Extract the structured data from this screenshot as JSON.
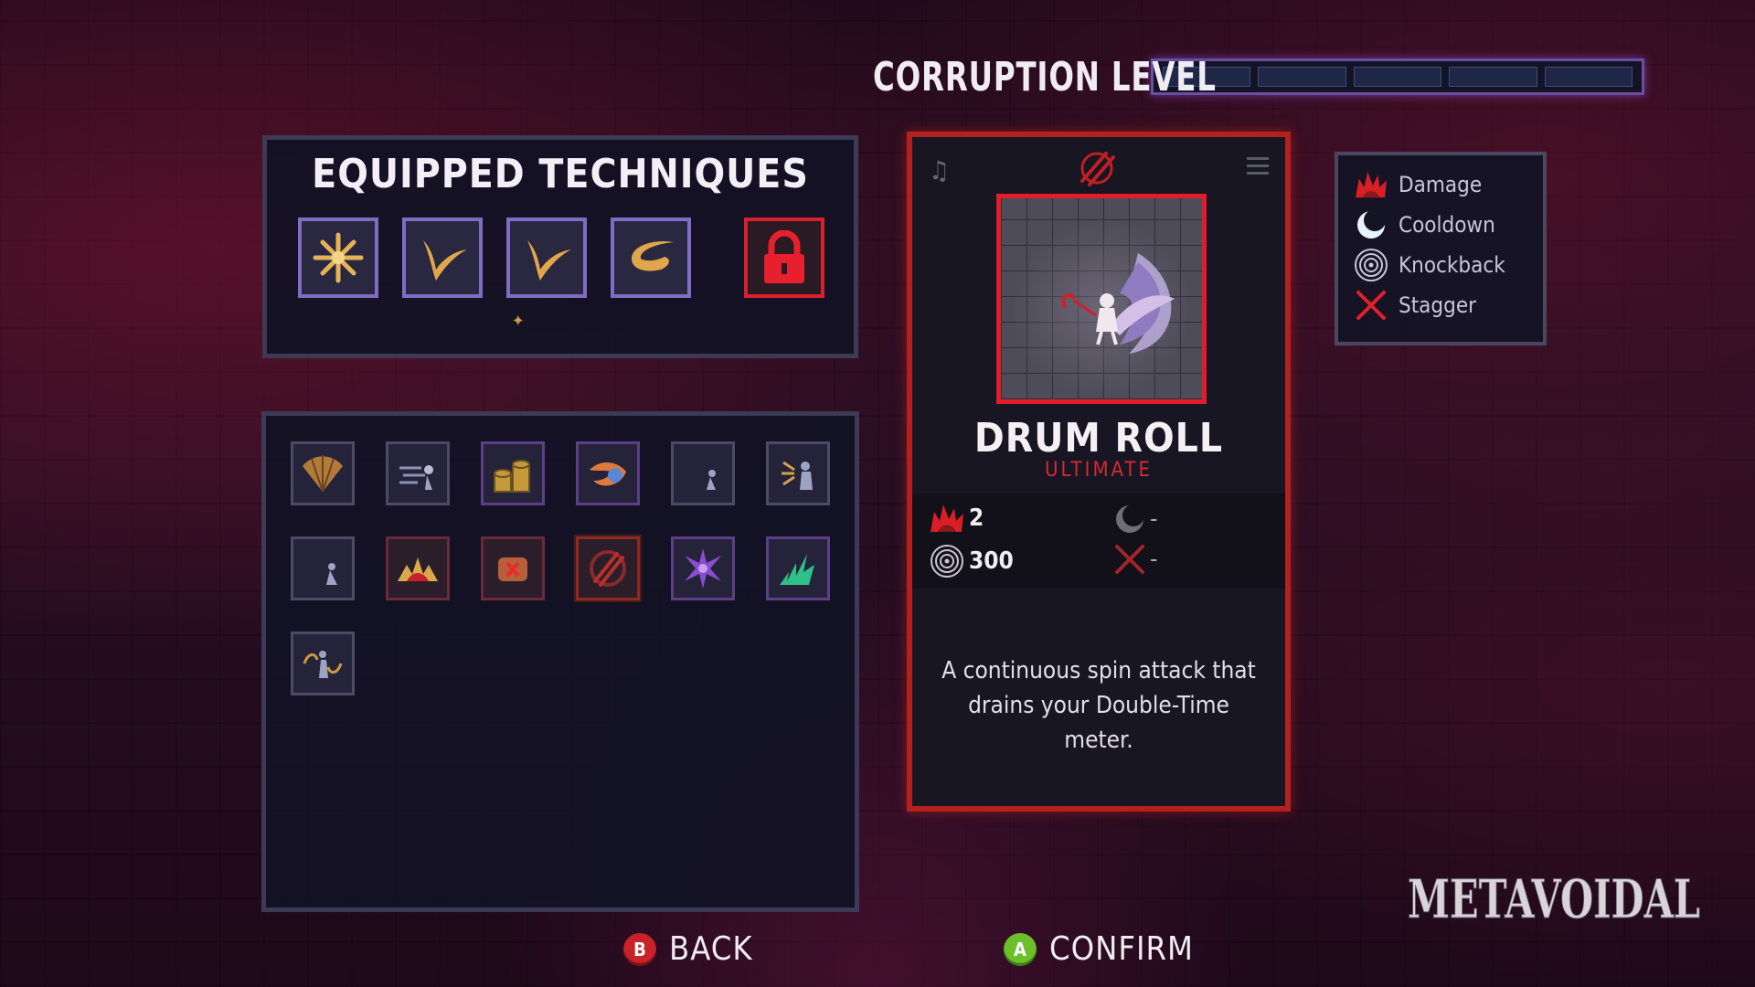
{
  "corruption": {
    "title": "CORRUPTION LEVEL",
    "segments": 5,
    "filled": 0
  },
  "equipped": {
    "title": "EQUIPPED TECHNIQUES",
    "slots": [
      {
        "icon": "starburst-icon"
      },
      {
        "icon": "crescent-slash-icon"
      },
      {
        "icon": "crescent-slash-icon"
      },
      {
        "icon": "spin-arc-icon"
      },
      {
        "icon": "lock-icon",
        "locked": true
      }
    ]
  },
  "inventory": {
    "items": [
      {
        "icon": "fan-icon"
      },
      {
        "icon": "dash-strike-icon"
      },
      {
        "icon": "coin-stack-icon"
      },
      {
        "icon": "fireball-icon"
      },
      {
        "icon": "moon-figure-icon"
      },
      {
        "icon": "burst-figure-icon"
      },
      {
        "icon": "moon-slash-icon"
      },
      {
        "icon": "flame-crown-icon"
      },
      {
        "icon": "red-fist-icon"
      },
      {
        "icon": "drum-roll-icon"
      },
      {
        "icon": "purple-star-icon"
      },
      {
        "icon": "green-spark-icon"
      },
      {
        "icon": "swirl-figure-icon"
      }
    ]
  },
  "detail": {
    "name": "DRUM ROLL",
    "subtitle": "ULTIMATE",
    "stats": {
      "damage": "2",
      "knockback": "300",
      "cooldown": "-",
      "stagger": "-"
    },
    "description": "A continuous spin attack that drains your Double-Time meter."
  },
  "legend": {
    "damage": "Damage",
    "cooldown": "Cooldown",
    "knockback": "Knockback",
    "stagger": "Stagger"
  },
  "footer": {
    "back": "BACK",
    "confirm": "CONFIRM",
    "back_key": "B",
    "confirm_key": "A"
  },
  "watermark": "METAVOIDAL",
  "colors": {
    "accent_red": "#d42a34",
    "slot_purple": "#7f6dc3",
    "panel_bg": "#121224"
  }
}
